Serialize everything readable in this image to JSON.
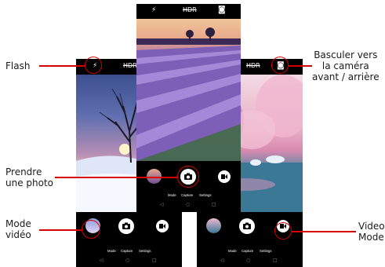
{
  "annotations": {
    "flash": "Flash",
    "switch_line1": "Basculer vers",
    "switch_line2": "la caméra",
    "switch_line3": "avant / arrière",
    "photo_line1": "Prendre",
    "photo_line2": "une photo",
    "mode_line1": "Mode",
    "mode_line2": "vidéo",
    "video_line1": "Video",
    "video_line2": "Mode"
  },
  "camera": {
    "mode_label": "Mode",
    "capture_label": "Capture",
    "settings_label": "Settings"
  },
  "icons": {
    "flash": "flash-icon",
    "hdr_off": "hdr-off-icon",
    "switch": "switch-camera-icon",
    "shutter": "camera-icon",
    "video": "video-icon",
    "nav_back": "back-icon",
    "nav_home": "home-icon",
    "nav_recent": "recent-apps-icon"
  },
  "colors": {
    "annotation": "#d60000",
    "bar": "#000000",
    "button": "#ffffff"
  }
}
